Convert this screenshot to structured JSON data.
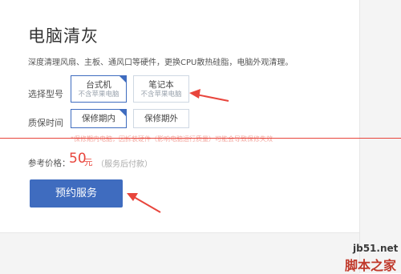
{
  "title": "电脑清灰",
  "description": "深度清理风扇、主板、通风口等硬件，更换CPU散热硅脂，电脑外观清理。",
  "model": {
    "label": "选择型号",
    "options": [
      {
        "name": "台式机",
        "note": "不含苹果电脑",
        "selected": true
      },
      {
        "name": "笔记本",
        "note": "不含苹果电脑",
        "selected": false
      }
    ]
  },
  "warranty": {
    "label": "质保时间",
    "options": [
      {
        "name": "保修期内",
        "selected": true
      },
      {
        "name": "保修期外",
        "selected": false
      }
    ]
  },
  "notice": "*保修期内电脑，因拆装硬件（影响电脑运行质量）可能会导致保修失效",
  "price": {
    "label": "参考价格：",
    "value": "50",
    "unit": "元",
    "note": "（服务后付款）"
  },
  "book_button": "预约服务",
  "colors": {
    "accent": "#3f6cbf",
    "price_red": "#e8453c",
    "annotation_red": "#e8453c"
  },
  "watermark": {
    "site": "jb51.net",
    "name": "脚本之家"
  }
}
